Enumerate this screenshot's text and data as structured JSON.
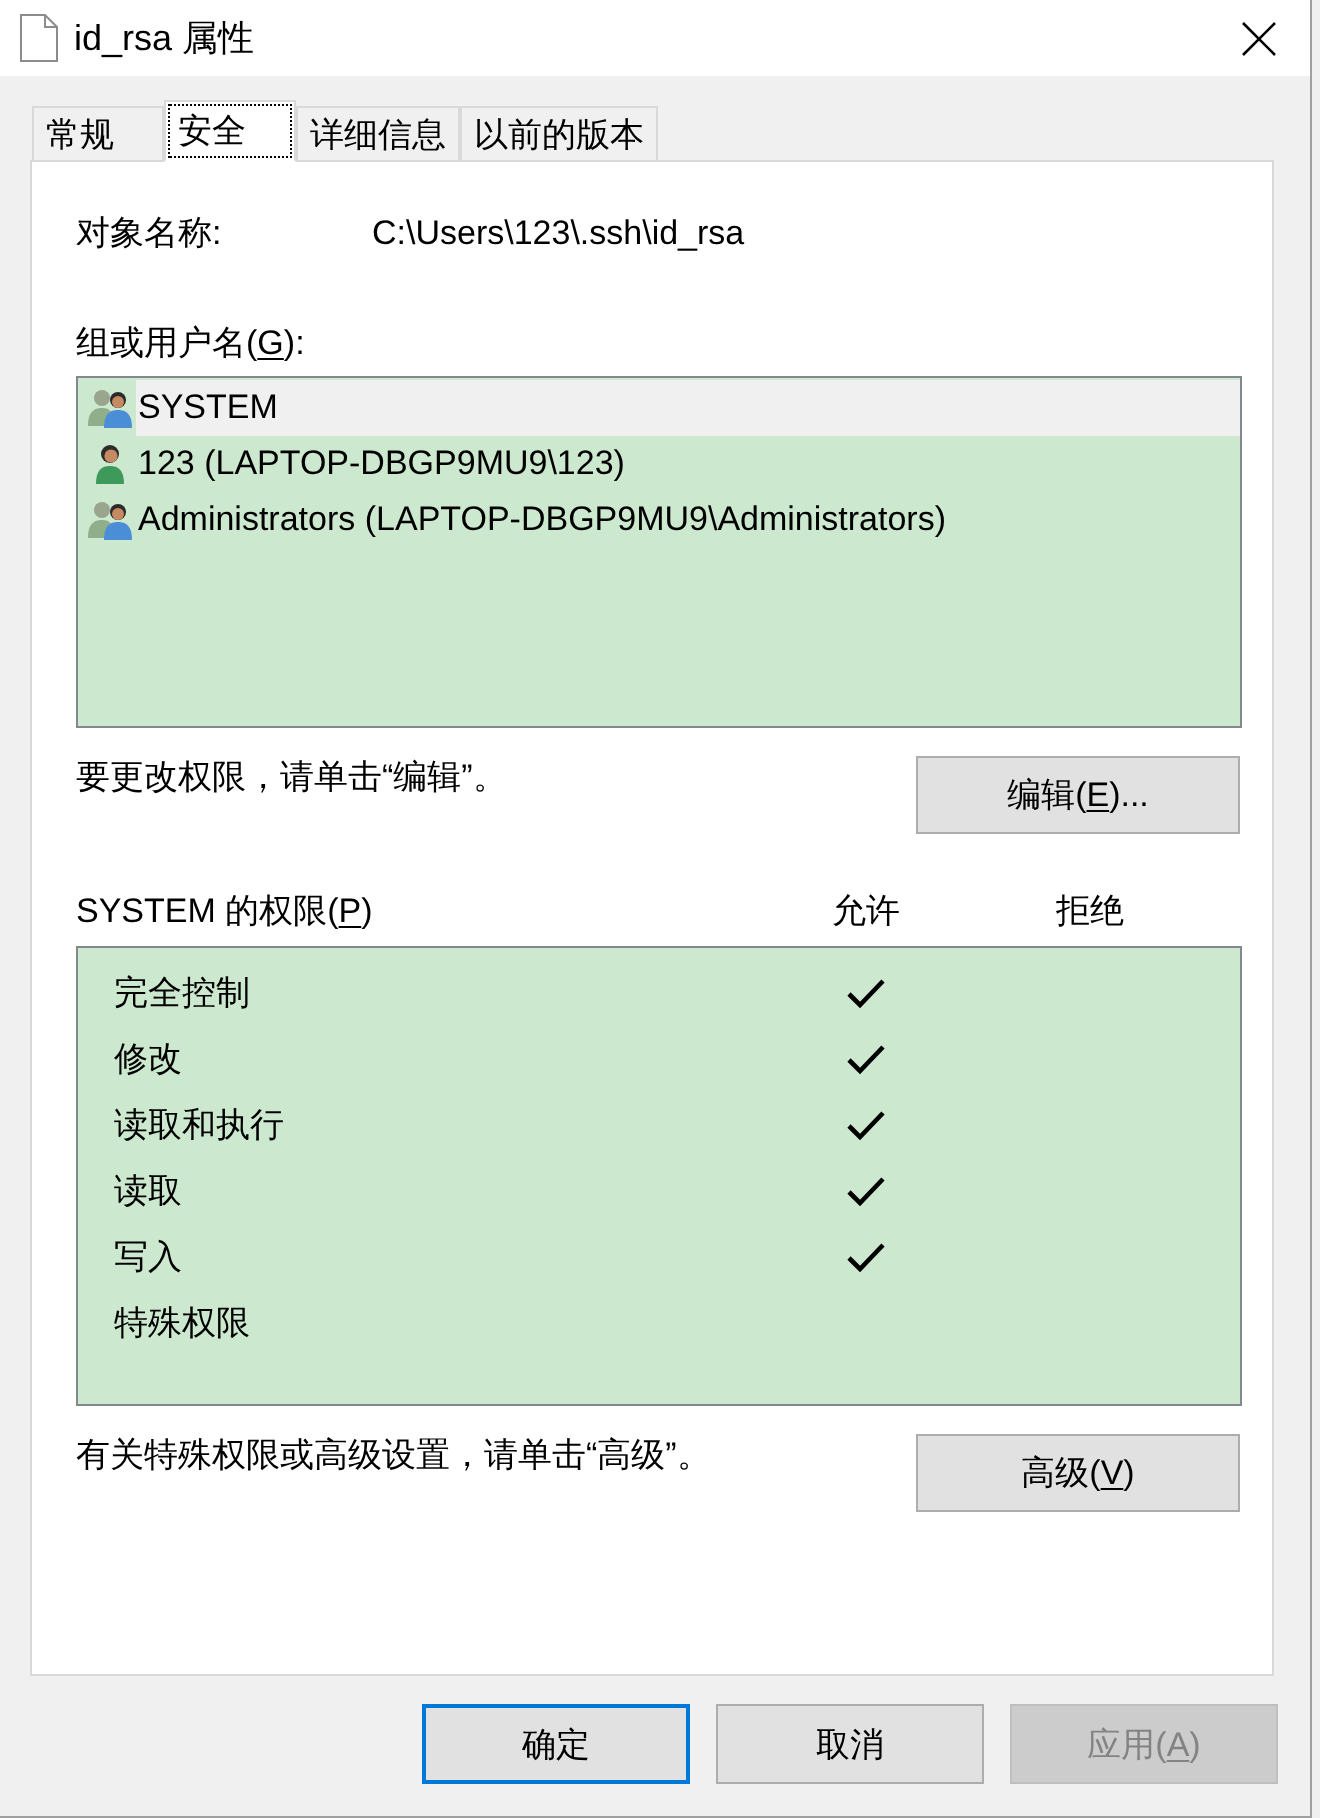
{
  "window": {
    "title": "id_rsa 属性"
  },
  "tabs": [
    {
      "label": "常规",
      "selected": false
    },
    {
      "label": "安全",
      "selected": true
    },
    {
      "label": "详细信息",
      "selected": false
    },
    {
      "label": "以前的版本",
      "selected": false
    }
  ],
  "object_name": {
    "label": "对象名称:",
    "value": "C:\\Users\\123\\.ssh\\id_rsa"
  },
  "groups": {
    "label": {
      "pre": "组或用户名(",
      "key": "G",
      "post": "):"
    },
    "items": [
      {
        "kind": "group",
        "name": "SYSTEM",
        "selected": true
      },
      {
        "kind": "user",
        "name": "123 (LAPTOP-DBGP9MU9\\123)",
        "selected": false
      },
      {
        "kind": "group",
        "name": "Administrators (LAPTOP-DBGP9MU9\\Administrators)",
        "selected": false
      }
    ]
  },
  "edit_hint": "要更改权限，请单击“编辑”。",
  "edit_button": {
    "pre": "编辑(",
    "key": "E",
    "post": ")..."
  },
  "permissions": {
    "label": {
      "pre": "SYSTEM 的权限(",
      "key": "P",
      "post": ")"
    },
    "allow_header": "允许",
    "deny_header": "拒绝",
    "rows": [
      {
        "name": "完全控制",
        "allow": true,
        "deny": false
      },
      {
        "name": "修改",
        "allow": true,
        "deny": false
      },
      {
        "name": "读取和执行",
        "allow": true,
        "deny": false
      },
      {
        "name": "读取",
        "allow": true,
        "deny": false
      },
      {
        "name": "写入",
        "allow": true,
        "deny": false
      },
      {
        "name": "特殊权限",
        "allow": false,
        "deny": false
      }
    ]
  },
  "advanced_hint": "有关特殊权限或高级设置，请单击“高级”。",
  "advanced_button": {
    "pre": "高级(",
    "key": "V",
    "post": ")"
  },
  "buttons": [
    {
      "label": "确定",
      "default": true,
      "disabled": false
    },
    {
      "label": "取消",
      "default": false,
      "disabled": false
    },
    {
      "label": {
        "pre": "应用(",
        "key": "A",
        "post": ")"
      },
      "default": false,
      "disabled": true
    }
  ]
}
